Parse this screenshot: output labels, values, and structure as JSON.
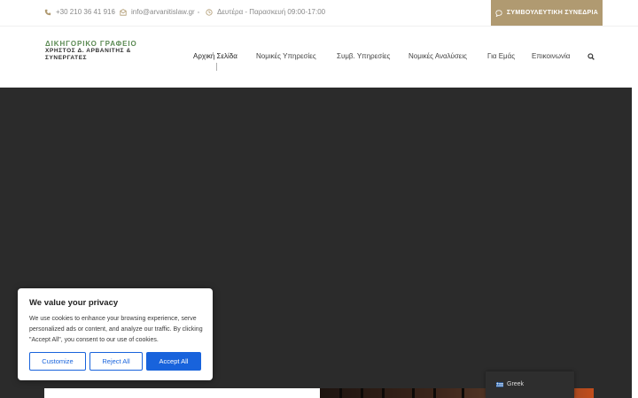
{
  "topbar": {
    "phone": "+30 210 36 41 916",
    "email": "info@arvanitislaw.gr",
    "hours": "Δευτέρα - Παρασκευή 09:00-17:00",
    "cta_label": "ΣΥΜΒΟΥΛΕΥΤΙΚΗ ΣΥΝΕΔΡΙΑ",
    "icons": [
      "phone-icon",
      "mail-icon",
      "clock-icon",
      "chat-bubble-icon"
    ],
    "accent_color": "#b09a71"
  },
  "logo": {
    "line1": "ΔΙΚΗΓΟΡΙΚΟ ΓΡΑΦΕΙΟ",
    "line2": "ΧΡΗΣΤΟΣ Δ. ΑΡΒΑΝΙΤΗΣ & ΣΥΝΕΡΓΑΤΕΣ",
    "color_line1": "#5b8a53"
  },
  "nav": {
    "items": [
      {
        "label": "Αρχική Σελίδα",
        "active": true
      },
      {
        "label": "Νομικές Υπηρεσίες"
      },
      {
        "label": "Συμβ. Υπηρεσίες"
      },
      {
        "label": "Νομικές Αναλύσεις"
      },
      {
        "label": "Για Εμάς"
      },
      {
        "label": "Επικοινωνία"
      }
    ],
    "search_icon": "search-icon"
  },
  "cookie": {
    "title": "We value your privacy",
    "text": "We use cookies to enhance your browsing experience, serve personalized ads or content, and analyze our traffic. By clicking \"Accept All\", you consent to our use of cookies.",
    "customize": "Customize",
    "reject": "Reject All",
    "accept": "Accept All",
    "accent_color": "#1863dc"
  },
  "language": {
    "label": "Greek",
    "flag_icon": "greek-flag-icon"
  }
}
